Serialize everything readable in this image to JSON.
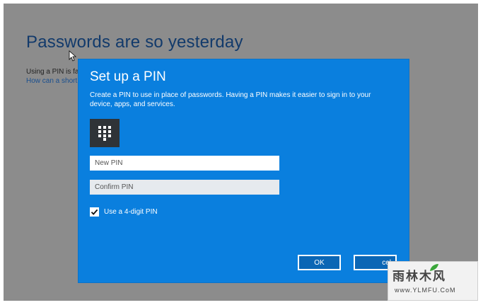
{
  "background_page": {
    "title": "Passwords are so yesterday",
    "text": "Using a PIN is fa",
    "link": "How can a short"
  },
  "dialog": {
    "title": "Set up a PIN",
    "description": "Create a PIN to use in place of passwords. Having a PIN makes it easier to sign in to your device, apps, and services.",
    "icon": "keypad-icon",
    "new_pin": {
      "placeholder": "New PIN",
      "value": ""
    },
    "confirm_pin": {
      "placeholder": "Confirm PIN",
      "value": ""
    },
    "four_digit_checkbox": {
      "label": "Use a 4-digit PIN",
      "checked": true
    },
    "ok_label": "OK",
    "cancel_label": "cel"
  },
  "watermark": {
    "logo": "雨林木风",
    "url": "www.YLMFU.CoM"
  },
  "colors": {
    "dialog_background": "#0a7fde",
    "screen_background": "#8c8c8c",
    "title_text": "#123a6b"
  }
}
